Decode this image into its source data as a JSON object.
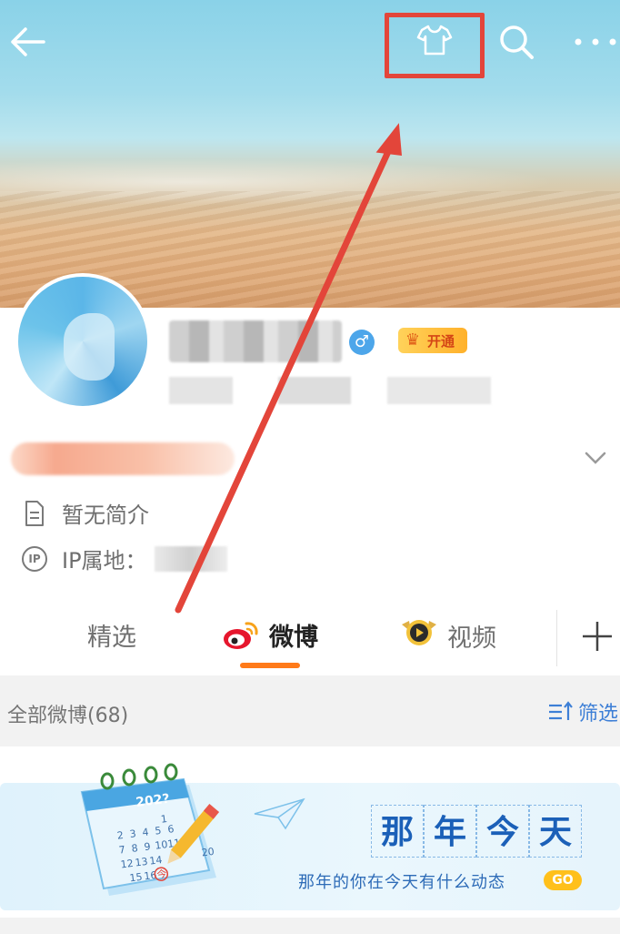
{
  "cover": {
    "back_icon": "arrow-left-icon",
    "tshirt_icon": "tshirt-icon",
    "search_icon": "search-icon",
    "more_icon": "more-dots-icon"
  },
  "profile": {
    "gender_symbol": "♂",
    "vip_label": "开通",
    "bio_label": "暂无简介",
    "ip_label": "IP属地：",
    "ip_badge": "IP"
  },
  "tabs": {
    "items": [
      {
        "label": "精选"
      },
      {
        "label": "微博"
      },
      {
        "label": "视频"
      }
    ],
    "active_index": 1,
    "add_icon": "plus-icon"
  },
  "feed": {
    "count_label": "全部微博(68)",
    "filter_label": "筛选"
  },
  "banner": {
    "title_chars": [
      "那",
      "年",
      "今",
      "天"
    ],
    "subtitle": "那年的你在今天有什么动态",
    "go_label": "GO",
    "calendar_year": "202?",
    "calendar_days": [
      "1",
      "2",
      "3",
      "4",
      "5",
      "6",
      "7",
      "8",
      "9",
      "10",
      "11",
      "12",
      "13",
      "14",
      "15",
      "16",
      "今",
      "20"
    ]
  },
  "colors": {
    "accent": "#ff7a19",
    "highlight_box": "#e3453a",
    "link_blue": "#3d7fd6"
  }
}
